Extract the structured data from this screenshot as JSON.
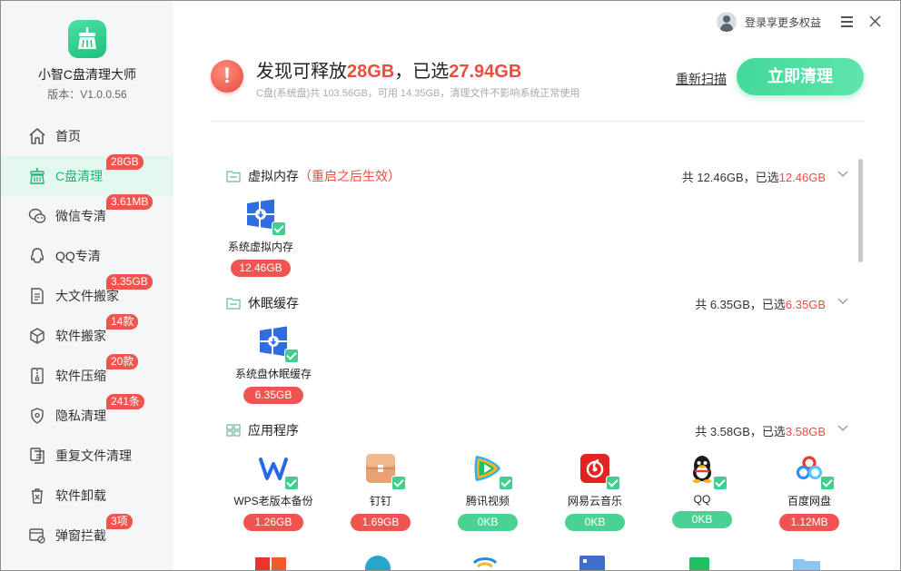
{
  "app": {
    "name": "小智C盘清理大师",
    "version": "版本：V1.0.0.56"
  },
  "header": {
    "login_text": "登录享更多权益"
  },
  "sidebar": {
    "items": [
      {
        "label": "首页",
        "icon": "home-icon",
        "badge": null,
        "active": false
      },
      {
        "label": "C盘清理",
        "icon": "broom-icon",
        "badge": "28GB",
        "active": true
      },
      {
        "label": "微信专清",
        "icon": "wechat-icon",
        "badge": "3.61MB",
        "active": false
      },
      {
        "label": "QQ专清",
        "icon": "qq-icon",
        "badge": null,
        "active": false
      },
      {
        "label": "大文件搬家",
        "icon": "file-move-icon",
        "badge": "3.35GB",
        "active": false
      },
      {
        "label": "软件搬家",
        "icon": "box-move-icon",
        "badge": "14款",
        "active": false
      },
      {
        "label": "软件压缩",
        "icon": "zip-icon",
        "badge": "20款",
        "active": false
      },
      {
        "label": "隐私清理",
        "icon": "shield-icon",
        "badge": "241条",
        "active": false
      },
      {
        "label": "重复文件清理",
        "icon": "duplicate-file-icon",
        "badge": null,
        "active": false
      },
      {
        "label": "软件卸载",
        "icon": "uninstall-icon",
        "badge": null,
        "active": false
      },
      {
        "label": "弹窗拦截",
        "icon": "popup-block-icon",
        "badge": "3项",
        "active": false
      }
    ]
  },
  "summary": {
    "prefix": "发现可释放",
    "releasable": "28GB",
    "middle": "，已选",
    "selected": "27.94GB",
    "disk_info": "C盘(系统盘)共 103.56GB，可用 14.35GB，清理文件不影响系统正常使用",
    "rescan_label": "重新扫描",
    "clean_label": "立即清理"
  },
  "sections": [
    {
      "title": "虚拟内存",
      "note": "（重启之后生效）",
      "total": "共 12.46GB，已选",
      "selected": "12.46GB",
      "items": [
        {
          "label": "系统虚拟内存",
          "size": "12.46GB",
          "icon": "windows-icon",
          "tone": "red"
        }
      ]
    },
    {
      "title": "休眠缓存",
      "note": "",
      "total": "共 6.35GB，已选",
      "selected": "6.35GB",
      "items": [
        {
          "label": "系统盘休眠缓存",
          "size": "6.35GB",
          "icon": "windows-icon",
          "tone": "red"
        }
      ]
    },
    {
      "title": "应用程序",
      "note": "",
      "total": "共 3.58GB，已选",
      "selected": "3.58GB",
      "items": [
        {
          "label": "WPS老版本备份",
          "size": "1.26GB",
          "icon": "wps-icon",
          "tone": "red"
        },
        {
          "label": "钉钉",
          "size": "1.69GB",
          "icon": "dingtalk-icon",
          "tone": "red"
        },
        {
          "label": "腾讯视频",
          "size": "0KB",
          "icon": "tencent-video-icon",
          "tone": "green"
        },
        {
          "label": "网易云音乐",
          "size": "0KB",
          "icon": "netease-music-icon",
          "tone": "green"
        },
        {
          "label": "QQ",
          "size": "0KB",
          "icon": "qq-penguin-icon",
          "tone": "green"
        },
        {
          "label": "百度网盘",
          "size": "1.12MB",
          "icon": "baidu-netdisk-icon",
          "tone": "red"
        }
      ]
    }
  ]
}
